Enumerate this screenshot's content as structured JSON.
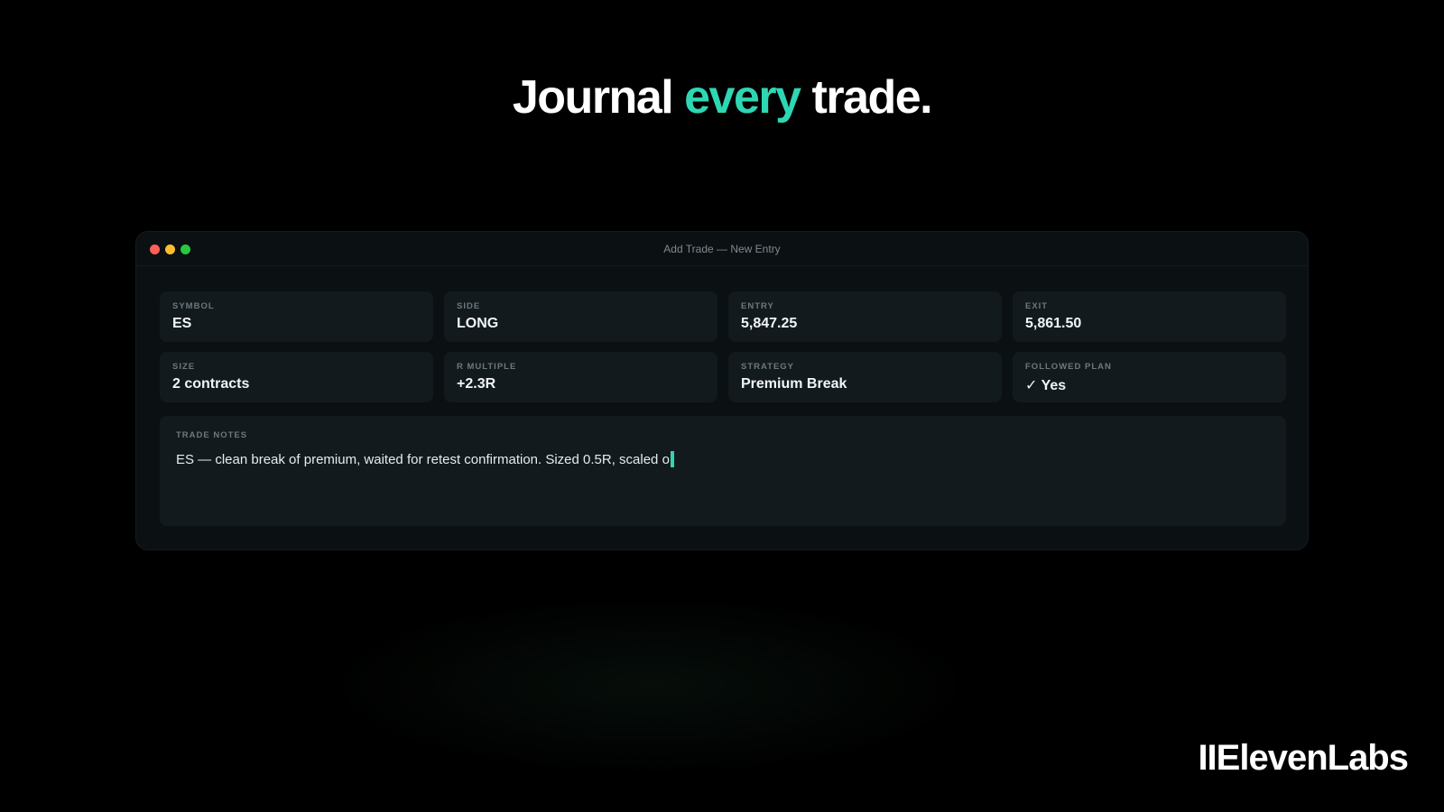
{
  "headline": {
    "part1": "Journal ",
    "accent": "every",
    "part2": " trade."
  },
  "window": {
    "title": "Add Trade — New Entry",
    "controls": [
      "close",
      "minimize",
      "maximize"
    ]
  },
  "fields": {
    "symbol": {
      "label": "SYMBOL",
      "value": "ES"
    },
    "side": {
      "label": "SIDE",
      "value": "LONG"
    },
    "entry": {
      "label": "ENTRY",
      "value": "5,847.25"
    },
    "exit": {
      "label": "EXIT",
      "value": "5,861.50"
    },
    "size": {
      "label": "SIZE",
      "value": "2 contracts"
    },
    "r_multiple": {
      "label": "R MULTIPLE",
      "value": "+2.3R"
    },
    "strategy": {
      "label": "STRATEGY",
      "value": "Premium Break"
    },
    "followed_plan": {
      "label": "FOLLOWED PLAN",
      "value": "✓ Yes"
    }
  },
  "notes": {
    "label": "TRADE NOTES",
    "value": "ES — clean break of premium, waited for retest confirmation. Sized 0.5R, scaled o"
  },
  "brand": {
    "name": "IIElevenLabs"
  },
  "colors": {
    "accent": "#2fd6b3",
    "background": "#000000",
    "panel": "#0b1013",
    "field": "#121a1e",
    "dot_red": "#ff5f57",
    "dot_yellow": "#febc2e",
    "dot_green": "#28c840"
  }
}
